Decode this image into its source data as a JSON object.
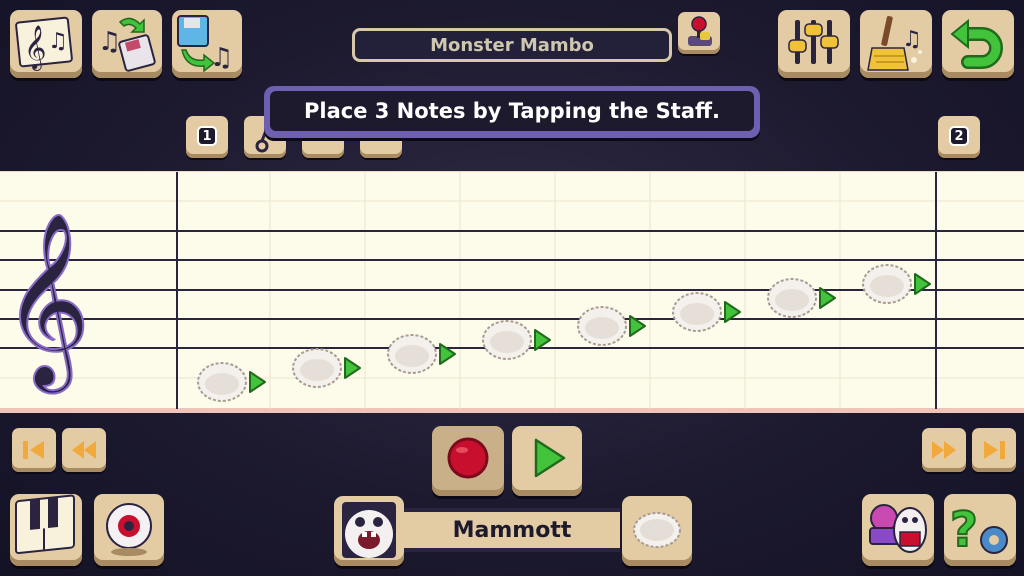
{
  "song": {
    "title": "Monster Mambo"
  },
  "instruction": {
    "text": "Place 3 Notes by Tapping the Staff."
  },
  "pages": {
    "current": "1",
    "next": "2"
  },
  "monster": {
    "name": "Mammott"
  },
  "notes": [
    {
      "pitch": 1
    },
    {
      "pitch": 2
    },
    {
      "pitch": 3
    },
    {
      "pitch": 4
    },
    {
      "pitch": 5
    },
    {
      "pitch": 6
    },
    {
      "pitch": 7
    },
    {
      "pitch": 8
    }
  ],
  "colors": {
    "record": "#c8102e",
    "play": "#43c23c",
    "banner_border": "#6e5fb0",
    "tile": "#e3cba4"
  },
  "icons": {
    "top_left": [
      "song-sheet-icon",
      "save-songs-icon",
      "load-song-icon"
    ],
    "top_right": [
      "mixer-icon",
      "clear-icon",
      "undo-icon"
    ],
    "transport": [
      "skip-start-icon",
      "step-back-icon",
      "record-icon",
      "play-icon",
      "step-forward-icon",
      "skip-end-icon"
    ],
    "bottom": [
      "piano-icon",
      "eyeball-icon",
      "mammott-portrait-icon",
      "fluff-note-icon",
      "monster-collection-icon",
      "help-settings-icon"
    ]
  }
}
